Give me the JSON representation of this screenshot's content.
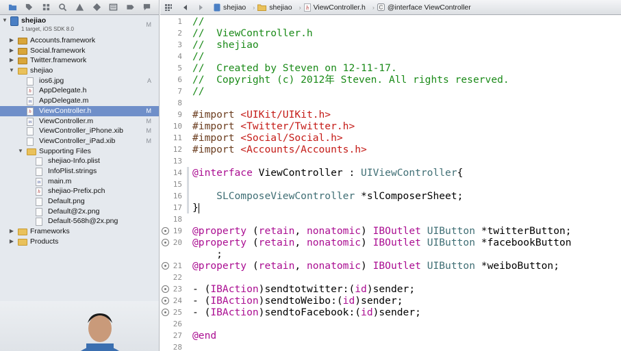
{
  "navigator": {
    "toolbar_icons": [
      "folder-icon",
      "tag-icon",
      "symbol-icon",
      "search-icon",
      "warning-icon",
      "tests-icon",
      "debug-icon",
      "breakpoint-icon",
      "log-icon"
    ],
    "project": {
      "name": "shejiao",
      "subtitle": "1 target, iOS SDK 8.0",
      "badge": "M"
    },
    "items": [
      {
        "label": "Accounts.framework",
        "icon": "framework-icon",
        "disclosure": "▶",
        "badge": "",
        "selected": false
      },
      {
        "label": "Social.framework",
        "icon": "framework-icon",
        "disclosure": "▶",
        "badge": "",
        "selected": false
      },
      {
        "label": "Twitter.framework",
        "icon": "framework-icon",
        "disclosure": "▶",
        "badge": "",
        "selected": false
      },
      {
        "label": "shejiao",
        "icon": "folder-icon",
        "disclosure": "▼",
        "badge": "",
        "selected": false
      },
      {
        "label": "ios6.jpg",
        "icon": "image-file-icon",
        "disclosure": "",
        "badge": "A",
        "selected": false
      },
      {
        "label": "AppDelegate.h",
        "icon": "header-file-icon",
        "disclosure": "",
        "badge": "",
        "selected": false
      },
      {
        "label": "AppDelegate.m",
        "icon": "source-file-icon",
        "disclosure": "",
        "badge": "",
        "selected": false
      },
      {
        "label": "ViewController.h",
        "icon": "header-file-icon",
        "disclosure": "",
        "badge": "M",
        "selected": true
      },
      {
        "label": "ViewController.m",
        "icon": "source-file-icon",
        "disclosure": "",
        "badge": "M",
        "selected": false
      },
      {
        "label": "ViewController_iPhone.xib",
        "icon": "xib-file-icon",
        "disclosure": "",
        "badge": "M",
        "selected": false
      },
      {
        "label": "ViewController_iPad.xib",
        "icon": "xib-file-icon",
        "disclosure": "",
        "badge": "M",
        "selected": false
      },
      {
        "label": "Supporting Files",
        "icon": "folder-icon",
        "disclosure": "▼",
        "badge": "",
        "selected": false
      },
      {
        "label": "shejiao-Info.plist",
        "icon": "plist-file-icon",
        "disclosure": "",
        "badge": "",
        "selected": false
      },
      {
        "label": "InfoPlist.strings",
        "icon": "strings-file-icon",
        "disclosure": "",
        "badge": "",
        "selected": false
      },
      {
        "label": "main.m",
        "icon": "source-file-icon",
        "disclosure": "",
        "badge": "",
        "selected": false
      },
      {
        "label": "shejiao-Prefix.pch",
        "icon": "header-file-icon",
        "disclosure": "",
        "badge": "",
        "selected": false
      },
      {
        "label": "Default.png",
        "icon": "image-file-icon",
        "disclosure": "",
        "badge": "",
        "selected": false
      },
      {
        "label": "Default@2x.png",
        "icon": "image-file-icon",
        "disclosure": "",
        "badge": "",
        "selected": false
      },
      {
        "label": "Default-568h@2x.png",
        "icon": "image-file-icon",
        "disclosure": "",
        "badge": "",
        "selected": false
      },
      {
        "label": "Frameworks",
        "icon": "folder-icon",
        "disclosure": "▶",
        "badge": "",
        "selected": false
      },
      {
        "label": "Products",
        "icon": "folder-icon",
        "disclosure": "▶",
        "badge": "",
        "selected": false
      }
    ]
  },
  "jumpbar": {
    "crumbs": [
      "shejiao",
      "shejiao",
      "ViewController.h",
      "@interface ViewController"
    ]
  },
  "editor": {
    "colors": {
      "comment": "#1a8a18",
      "directive": "#6b3d1f",
      "string": "#c41a16",
      "keyword": "#aa0d91",
      "class": "#3f6e74"
    },
    "lines": [
      {
        "n": "1",
        "tokens": [
          {
            "t": "//",
            "c": "comment"
          }
        ]
      },
      {
        "n": "2",
        "tokens": [
          {
            "t": "//  ViewController.h",
            "c": "comment"
          }
        ]
      },
      {
        "n": "3",
        "tokens": [
          {
            "t": "//  shejiao",
            "c": "comment"
          }
        ]
      },
      {
        "n": "4",
        "tokens": [
          {
            "t": "//",
            "c": "comment"
          }
        ]
      },
      {
        "n": "5",
        "tokens": [
          {
            "t": "//  Created by Steven on 12-11-17.",
            "c": "comment"
          }
        ]
      },
      {
        "n": "6",
        "tokens": [
          {
            "t": "//  Copyright (c) 2012年 Steven. All rights reserved.",
            "c": "comment"
          }
        ]
      },
      {
        "n": "7",
        "tokens": [
          {
            "t": "//",
            "c": "comment"
          }
        ]
      },
      {
        "n": "8",
        "tokens": []
      },
      {
        "n": "9",
        "tokens": [
          {
            "t": "#import ",
            "c": "directive"
          },
          {
            "t": "<UIKit/UIKit.h>",
            "c": "string"
          }
        ]
      },
      {
        "n": "10",
        "tokens": [
          {
            "t": "#import ",
            "c": "directive"
          },
          {
            "t": "<Twitter/Twitter.h>",
            "c": "string"
          }
        ]
      },
      {
        "n": "11",
        "tokens": [
          {
            "t": "#import ",
            "c": "directive"
          },
          {
            "t": "<Social/Social.h>",
            "c": "string"
          }
        ]
      },
      {
        "n": "12",
        "tokens": [
          {
            "t": "#import ",
            "c": "directive"
          },
          {
            "t": "<Accounts/Accounts.h>",
            "c": "string"
          }
        ]
      },
      {
        "n": "13",
        "tokens": []
      },
      {
        "n": "14",
        "tokens": [
          {
            "t": "@interface",
            "c": "keyword"
          },
          {
            "t": " ViewController : ",
            "c": "plain"
          },
          {
            "t": "UIViewController",
            "c": "class"
          },
          {
            "t": "{",
            "c": "plain"
          }
        ]
      },
      {
        "n": "15",
        "tokens": []
      },
      {
        "n": "16",
        "tokens": [
          {
            "t": "    ",
            "c": "plain"
          },
          {
            "t": "SLComposeViewController",
            "c": "class"
          },
          {
            "t": " *slComposerSheet;",
            "c": "plain"
          }
        ]
      },
      {
        "n": "17",
        "tokens": [
          {
            "t": "}",
            "c": "plain"
          }
        ],
        "caret": true
      },
      {
        "n": "18",
        "tokens": []
      },
      {
        "n": "19",
        "connector": true,
        "tokens": [
          {
            "t": "@property",
            "c": "keyword"
          },
          {
            "t": " (",
            "c": "plain"
          },
          {
            "t": "retain",
            "c": "keyword"
          },
          {
            "t": ", ",
            "c": "plain"
          },
          {
            "t": "nonatomic",
            "c": "keyword"
          },
          {
            "t": ") ",
            "c": "plain"
          },
          {
            "t": "IBOutlet",
            "c": "keyword"
          },
          {
            "t": " ",
            "c": "plain"
          },
          {
            "t": "UIButton",
            "c": "class"
          },
          {
            "t": " *twitterButton;",
            "c": "plain"
          }
        ]
      },
      {
        "n": "20",
        "connector": true,
        "tokens": [
          {
            "t": "@property",
            "c": "keyword"
          },
          {
            "t": " (",
            "c": "plain"
          },
          {
            "t": "retain",
            "c": "keyword"
          },
          {
            "t": ", ",
            "c": "plain"
          },
          {
            "t": "nonatomic",
            "c": "keyword"
          },
          {
            "t": ") ",
            "c": "plain"
          },
          {
            "t": "IBOutlet",
            "c": "keyword"
          },
          {
            "t": " ",
            "c": "plain"
          },
          {
            "t": "UIButton",
            "c": "class"
          },
          {
            "t": " *facebookButton",
            "c": "plain"
          }
        ]
      },
      {
        "n": "",
        "tokens": [
          {
            "t": "    ;",
            "c": "plain"
          }
        ]
      },
      {
        "n": "21",
        "connector": true,
        "tokens": [
          {
            "t": "@property",
            "c": "keyword"
          },
          {
            "t": " (",
            "c": "plain"
          },
          {
            "t": "retain",
            "c": "keyword"
          },
          {
            "t": ", ",
            "c": "plain"
          },
          {
            "t": "nonatomic",
            "c": "keyword"
          },
          {
            "t": ") ",
            "c": "plain"
          },
          {
            "t": "IBOutlet",
            "c": "keyword"
          },
          {
            "t": " ",
            "c": "plain"
          },
          {
            "t": "UIButton",
            "c": "class"
          },
          {
            "t": " *weiboButton;",
            "c": "plain"
          }
        ]
      },
      {
        "n": "22",
        "tokens": []
      },
      {
        "n": "23",
        "connector": true,
        "tokens": [
          {
            "t": "- (",
            "c": "plain"
          },
          {
            "t": "IBAction",
            "c": "keyword"
          },
          {
            "t": ")sendtotwitter:(",
            "c": "plain"
          },
          {
            "t": "id",
            "c": "keyword"
          },
          {
            "t": ")sender;",
            "c": "plain"
          }
        ]
      },
      {
        "n": "24",
        "connector": true,
        "tokens": [
          {
            "t": "- (",
            "c": "plain"
          },
          {
            "t": "IBAction",
            "c": "keyword"
          },
          {
            "t": ")sendtoWeibo:(",
            "c": "plain"
          },
          {
            "t": "id",
            "c": "keyword"
          },
          {
            "t": ")sender;",
            "c": "plain"
          }
        ]
      },
      {
        "n": "25",
        "connector": true,
        "tokens": [
          {
            "t": "- (",
            "c": "plain"
          },
          {
            "t": "IBAction",
            "c": "keyword"
          },
          {
            "t": ")sendtoFacebook:(",
            "c": "plain"
          },
          {
            "t": "id",
            "c": "keyword"
          },
          {
            "t": ")sender;",
            "c": "plain"
          }
        ]
      },
      {
        "n": "26",
        "tokens": []
      },
      {
        "n": "27",
        "tokens": [
          {
            "t": "@end",
            "c": "keyword"
          }
        ]
      },
      {
        "n": "28",
        "tokens": []
      }
    ]
  }
}
